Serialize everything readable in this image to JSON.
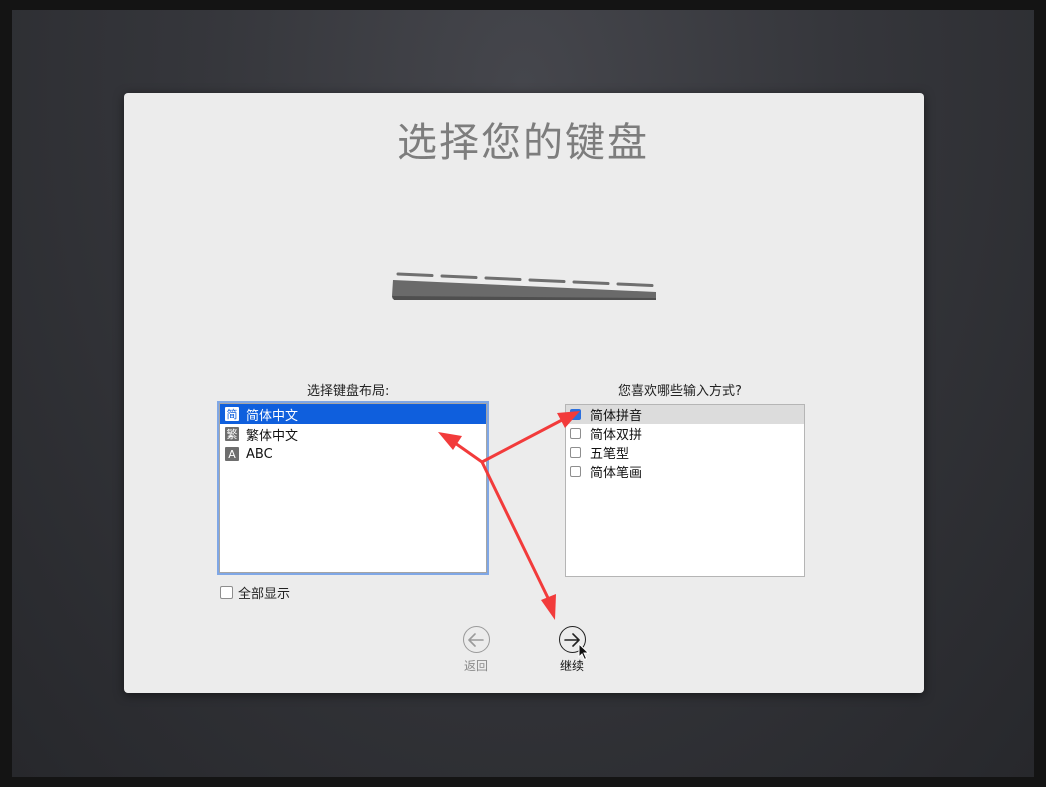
{
  "title": "选择您的键盘",
  "layout_label": "选择键盘布局:",
  "methods_label": "您喜欢哪些输入方式?",
  "layouts": [
    {
      "badge": "简",
      "name": "简体中文"
    },
    {
      "badge": "繁",
      "name": "繁体中文"
    },
    {
      "badge": "A",
      "name": "ABC"
    }
  ],
  "methods": [
    {
      "name": "简体拼音",
      "checked": true
    },
    {
      "name": "简体双拼",
      "checked": false
    },
    {
      "name": "五笔型",
      "checked": false
    },
    {
      "name": "简体笔画",
      "checked": false
    }
  ],
  "show_all": "全部显示",
  "back_label": "返回",
  "continue_label": "继续",
  "colors": {
    "selection": "#0f5fdd",
    "annotation": "#f23b3b"
  }
}
